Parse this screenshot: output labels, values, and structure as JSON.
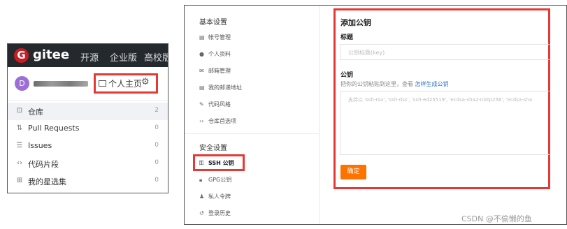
{
  "left": {
    "brand": "gitee",
    "logo_letter": "G",
    "nav": [
      "开源",
      "企业版",
      "高校版"
    ],
    "avatar_letter": "D",
    "homepage_label": "个人主页",
    "homepage_icon": "id-card-icon",
    "settings_icon": "gear-icon",
    "menu": [
      {
        "icon": "repo-icon",
        "glyph": "⊡",
        "label": "仓库",
        "count": "2",
        "active": true
      },
      {
        "icon": "pull-request-icon",
        "glyph": "⇅",
        "label": "Pull Requests",
        "count": "0"
      },
      {
        "icon": "issues-icon",
        "glyph": "☰",
        "label": "Issues",
        "count": "0"
      },
      {
        "icon": "code-icon",
        "glyph": "‹›",
        "label": "代码片段",
        "count": "0"
      },
      {
        "icon": "star-collection-icon",
        "glyph": "⊞",
        "label": "我的星选集",
        "count": "0"
      }
    ],
    "colors": {
      "nav_bg": "#24292e",
      "logo": "#c71d23",
      "highlight": "#e53935"
    }
  },
  "right": {
    "sidebar": {
      "section_basic": "基本设置",
      "basic_items": [
        {
          "icon": "id-card-icon",
          "glyph": "▤",
          "label": "帐号管理"
        },
        {
          "icon": "person-icon",
          "glyph": "●",
          "label": "个人资料"
        },
        {
          "icon": "mail-icon",
          "glyph": "✉",
          "label": "邮箱管理"
        },
        {
          "icon": "address-icon",
          "glyph": "▤",
          "label": "我的邮递地址"
        },
        {
          "icon": "brush-icon",
          "glyph": "✎",
          "label": "代码风格"
        },
        {
          "icon": "code-icon",
          "glyph": "‹›",
          "label": "仓库首选项"
        }
      ],
      "section_security": "安全设置",
      "security_items": [
        {
          "icon": "key-icon",
          "glyph": "⚿",
          "label": "SSH 公钥",
          "active": true
        },
        {
          "icon": "lock-icon",
          "glyph": "🔒︎",
          "label": "GPG公钥"
        },
        {
          "icon": "token-icon",
          "glyph": "♟",
          "label": "私人令牌"
        },
        {
          "icon": "history-icon",
          "glyph": "↺",
          "label": "登录历史"
        }
      ]
    },
    "form": {
      "title": "添加公钥",
      "title_label": "标题",
      "title_placeholder": "公钥标题(key)",
      "key_label": "公钥",
      "key_hint": "把你的公钥粘贴到这里，查看 ",
      "key_hint_link": "怎样生成公钥",
      "key_placeholder": "支持以 'ssh-rsa', 'ssh-dss', 'ssh-ed25519', 'ecdsa-sha2-nistp256', 'ecdsa-sha",
      "confirm_label": "确定"
    },
    "colors": {
      "button": "#fe7300",
      "link": "#2770c3"
    }
  },
  "watermark": "CSDN @不偷懒的鱼"
}
